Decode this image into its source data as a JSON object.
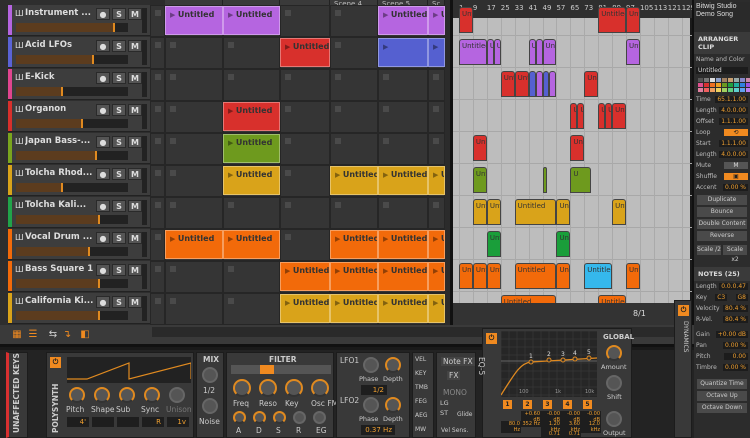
{
  "window": {
    "title": "Bitwig Studio Demo Song"
  },
  "tracks": [
    {
      "name": "Instrument ...",
      "color": "#b565e0",
      "level": 0.88
    },
    {
      "name": "Acid LFOs",
      "color": "#5a63d6",
      "level": 0.7
    },
    {
      "name": "E-Kick",
      "color": "#e0458f",
      "level": 0.42
    },
    {
      "name": "Organon",
      "color": "#d8302c",
      "level": 0.6
    },
    {
      "name": "Japan Bass-...",
      "color": "#7aa51e",
      "level": 0.72
    },
    {
      "name": "Tolcha Rhod...",
      "color": "#d9a31a",
      "level": 0.42
    },
    {
      "name": "Tolcha Kali...",
      "color": "#21a34a",
      "level": 0.75
    },
    {
      "name": "Vocal Drum ...",
      "color": "#f26a0a",
      "level": 0.66
    },
    {
      "name": "Bass Square 1",
      "color": "#f26a0a",
      "level": 0.75
    },
    {
      "name": "California Ki...",
      "color": "#d9a31a",
      "level": 0.75
    }
  ],
  "track_buttons": {
    "solo": "S",
    "mute": "M"
  },
  "scenes": [
    "",
    "",
    "",
    "Scene 4",
    "Scene 5",
    "Sc"
  ],
  "launcher_clips": [
    {
      "track": 0,
      "scene": 0,
      "label": "Untitled",
      "color": "#b565e0"
    },
    {
      "track": 0,
      "scene": 1,
      "label": "Untitled",
      "color": "#b565e0"
    },
    {
      "track": 0,
      "scene": 4,
      "label": "Untitled",
      "color": "#b565e0"
    },
    {
      "track": 0,
      "scene": 5,
      "label": "Un",
      "color": "#b565e0"
    },
    {
      "track": 1,
      "scene": 2,
      "label": "Untitled",
      "color": "#d8302c"
    },
    {
      "track": 1,
      "scene": 4,
      "label": "",
      "color": "#5560d0"
    },
    {
      "track": 1,
      "scene": 5,
      "label": "",
      "color": "#5560d0"
    },
    {
      "track": 3,
      "scene": 1,
      "label": "Untitled",
      "color": "#d8302c"
    },
    {
      "track": 4,
      "scene": 1,
      "label": "Untitled",
      "color": "#6e9a1e"
    },
    {
      "track": 5,
      "scene": 1,
      "label": "Untitled",
      "color": "#d9a31a"
    },
    {
      "track": 5,
      "scene": 3,
      "label": "Untitled",
      "color": "#d9a31a"
    },
    {
      "track": 5,
      "scene": 4,
      "label": "Untitled",
      "color": "#d9a31a"
    },
    {
      "track": 5,
      "scene": 5,
      "label": "Un",
      "color": "#d9a31a"
    },
    {
      "track": 7,
      "scene": 0,
      "label": "Untitled",
      "color": "#f26a0a"
    },
    {
      "track": 7,
      "scene": 1,
      "label": "Untitled",
      "color": "#f26a0a"
    },
    {
      "track": 7,
      "scene": 3,
      "label": "Untitled",
      "color": "#f26a0a"
    },
    {
      "track": 7,
      "scene": 4,
      "label": "Untitled",
      "color": "#f26a0a"
    },
    {
      "track": 7,
      "scene": 5,
      "label": "Un",
      "color": "#f26a0a"
    },
    {
      "track": 8,
      "scene": 2,
      "label": "Untitled",
      "color": "#f26a0a"
    },
    {
      "track": 8,
      "scene": 3,
      "label": "Untitled",
      "color": "#f26a0a"
    },
    {
      "track": 8,
      "scene": 4,
      "label": "Untitled",
      "color": "#f26a0a"
    },
    {
      "track": 8,
      "scene": 5,
      "label": "Un",
      "color": "#f26a0a"
    },
    {
      "track": 9,
      "scene": 2,
      "label": "Untitled",
      "color": "#d9a31a"
    },
    {
      "track": 9,
      "scene": 3,
      "label": "Untitled",
      "color": "#d9a31a"
    },
    {
      "track": 9,
      "scene": 4,
      "label": "Untitled",
      "color": "#d9a31a"
    },
    {
      "track": 9,
      "scene": 5,
      "label": "Un",
      "color": "#d9a31a"
    }
  ],
  "ruler": [
    "1",
    "9",
    "17",
    "25",
    "33",
    "41",
    "49",
    "57",
    "65",
    "73",
    "81",
    "89",
    "97",
    "105",
    "113",
    "121",
    "129"
  ],
  "arranger_clips": [
    {
      "track": -1,
      "start": 1,
      "end": 9,
      "label": "Unt",
      "color": "#d8302c"
    },
    {
      "track": 0,
      "start": 1,
      "end": 17,
      "label": "Untitled",
      "color": "#b565e0"
    },
    {
      "track": 0,
      "start": 17,
      "end": 21,
      "label": "U",
      "color": "#b565e0"
    },
    {
      "track": 0,
      "start": 21,
      "end": 25,
      "label": "U",
      "color": "#b565e0"
    },
    {
      "track": 0,
      "start": 41,
      "end": 45,
      "label": "U",
      "color": "#b565e0"
    },
    {
      "track": 0,
      "start": 45,
      "end": 49,
      "label": "",
      "color": "#b565e0"
    },
    {
      "track": 0,
      "start": 49,
      "end": 57,
      "label": "Unt",
      "color": "#b565e0"
    },
    {
      "track": -1,
      "start": 81,
      "end": 97,
      "label": "Untitled",
      "color": "#d8302c"
    },
    {
      "track": -1,
      "start": 97,
      "end": 105,
      "label": "Unt",
      "color": "#d8302c"
    },
    {
      "track": 1,
      "start": 25,
      "end": 33,
      "label": "Unt",
      "color": "#d8302c"
    },
    {
      "track": 1,
      "start": 33,
      "end": 41,
      "label": "Unt",
      "color": "#d8302c"
    },
    {
      "track": 1,
      "start": 41,
      "end": 45,
      "label": "",
      "color": "#5560d0"
    },
    {
      "track": 1,
      "start": 45,
      "end": 49,
      "label": "",
      "color": "#b565e0"
    },
    {
      "track": 1,
      "start": 49,
      "end": 53,
      "label": "",
      "color": "#5560d0"
    },
    {
      "track": 1,
      "start": 53,
      "end": 57,
      "label": "",
      "color": "#b565e0"
    },
    {
      "track": 1,
      "start": 73,
      "end": 81,
      "label": "Unt",
      "color": "#d8302c"
    },
    {
      "track": 0,
      "start": 97,
      "end": 105,
      "label": "Unt",
      "color": "#b565e0"
    },
    {
      "track": 2,
      "start": 65,
      "end": 69,
      "label": "U",
      "color": "#d8302c"
    },
    {
      "track": 2,
      "start": 69,
      "end": 73,
      "label": "U",
      "color": "#d8302c"
    },
    {
      "track": 2,
      "start": 81,
      "end": 85,
      "label": "U",
      "color": "#d8302c"
    },
    {
      "track": 2,
      "start": 85,
      "end": 89,
      "label": "U",
      "color": "#d8302c"
    },
    {
      "track": 2,
      "start": 89,
      "end": 97,
      "label": "Unt",
      "color": "#d8302c"
    },
    {
      "track": 3,
      "start": 9,
      "end": 17,
      "label": "Un",
      "color": "#d8302c"
    },
    {
      "track": 3,
      "start": 65,
      "end": 73,
      "label": "Unt",
      "color": "#d8302c"
    },
    {
      "track": 4,
      "start": 9,
      "end": 17,
      "label": "Unt",
      "color": "#6e9a1e"
    },
    {
      "track": 4,
      "start": 49,
      "end": 50,
      "label": "",
      "color": "#6e9a1e"
    },
    {
      "track": 4,
      "start": 65,
      "end": 77,
      "label": "U",
      "color": "#6e9a1e"
    },
    {
      "track": 5,
      "start": 9,
      "end": 17,
      "label": "Unt",
      "color": "#d9a31a"
    },
    {
      "track": 5,
      "start": 17,
      "end": 25,
      "label": "Unt",
      "color": "#d9a31a"
    },
    {
      "track": 5,
      "start": 33,
      "end": 57,
      "label": "Untitled",
      "color": "#d9a31a"
    },
    {
      "track": 5,
      "start": 57,
      "end": 65,
      "label": "Unt",
      "color": "#d9a31a"
    },
    {
      "track": 5,
      "start": 89,
      "end": 97,
      "label": "Unt",
      "color": "#d9a31a"
    },
    {
      "track": 6,
      "start": 17,
      "end": 25,
      "label": "Unt",
      "color": "#1a9e3a"
    },
    {
      "track": 6,
      "start": 57,
      "end": 65,
      "label": "Unt",
      "color": "#1a9e3a"
    },
    {
      "track": 7,
      "start": 1,
      "end": 9,
      "label": "Un",
      "color": "#f26a0a"
    },
    {
      "track": 7,
      "start": 9,
      "end": 17,
      "label": "Unt",
      "color": "#f26a0a"
    },
    {
      "track": 7,
      "start": 17,
      "end": 25,
      "label": "Unt",
      "color": "#f26a0a"
    },
    {
      "track": 7,
      "start": 33,
      "end": 57,
      "label": "Untitled",
      "color": "#f26a0a"
    },
    {
      "track": 7,
      "start": 57,
      "end": 65,
      "label": "Unt",
      "color": "#f26a0a"
    },
    {
      "track": 7,
      "start": 73,
      "end": 89,
      "label": "Untitled",
      "color": "#35b8ec"
    },
    {
      "track": 7,
      "start": 97,
      "end": 105,
      "label": "Unt",
      "color": "#f26a0a"
    },
    {
      "track": 8,
      "start": 25,
      "end": 57,
      "label": "Untitled",
      "color": "#f26a0a"
    },
    {
      "track": 8,
      "start": 81,
      "end": 97,
      "label": "Untitled",
      "color": "#f26a0a"
    },
    {
      "track": 9,
      "start": 25,
      "end": 57,
      "label": "Untitled",
      "color": "#d9a31a"
    },
    {
      "track": 9,
      "start": 65,
      "end": 73,
      "label": "",
      "color": "#d9a31a"
    },
    {
      "track": 9,
      "start": 73,
      "end": 81,
      "label": "Unt",
      "color": "#d9a31a"
    },
    {
      "track": 9,
      "start": 81,
      "end": 85,
      "label": "Ur",
      "color": "#d9a31a"
    },
    {
      "track": 9,
      "start": 85,
      "end": 93,
      "label": "Unt",
      "color": "#d9a31a"
    }
  ],
  "arranger_footer": {
    "grid": "8/1"
  },
  "inspector": {
    "clip_header": "ARRANGER CLIP",
    "name_color_label": "Name and Color",
    "clip_name": "Untitled",
    "palette": [
      "#555",
      "#777",
      "#ddd",
      "#8fa0c8",
      "#a08060",
      "#c8a070",
      "#9aa",
      "#88c",
      "#c8a",
      "#e05090",
      "#d83030",
      "#f07020",
      "#f0a020",
      "#6a9a20",
      "#20a040",
      "#20b0a0",
      "#3080e0",
      "#a050e0",
      "#e080a0",
      "#f06060",
      "#f0a060",
      "#f0d060",
      "#a0d060",
      "#60d080",
      "#60d0d0",
      "#60a0f0",
      "#c080f0"
    ],
    "rows1": [
      {
        "label": "Time",
        "value": "65.1.1.00"
      },
      {
        "label": "Length",
        "value": "4.0.0.00"
      },
      {
        "label": "Offset",
        "value": "1.1.1.00"
      }
    ],
    "loop_label": "Loop",
    "rows2": [
      {
        "label": "Start",
        "value": "1.1.1.00"
      },
      {
        "label": "Length",
        "value": "4.0.0.00"
      }
    ],
    "mute_label": "Mute",
    "mute_button": "M",
    "shuffle_label": "Shuffle",
    "accent": {
      "label": "Accent",
      "value": "0.00 %"
    },
    "buttons": [
      "Duplicate",
      "Bounce",
      "Double Content",
      "Reverse"
    ],
    "scale_half": "Scale /2",
    "scale_double": "Scale x2",
    "notes_header": "NOTES (25)",
    "note_length": {
      "label": "Length",
      "value": "0.0.0.47"
    },
    "key": {
      "label": "Key",
      "low": "C3",
      "high": "G8"
    },
    "rows3": [
      {
        "label": "Velocity",
        "value": "80.4 %"
      },
      {
        "label": "R-Vel.",
        "value": "80.4 %"
      }
    ],
    "rows4": [
      {
        "label": "Gain",
        "value": "+0.00 dB"
      },
      {
        "label": "Pan",
        "value": "0.00 %"
      },
      {
        "label": "Pitch",
        "value": "0.00"
      },
      {
        "label": "Timbre",
        "value": "0.00 %"
      }
    ],
    "note_buttons": [
      "Quantize Time",
      "Octave Up",
      "Octave Down"
    ]
  },
  "device": {
    "layer": "UNAFFECTED KEYS",
    "synth": "POLYSYNTH",
    "osc_knobs": [
      "Pitch",
      "Shape",
      "Sub",
      "Sync",
      "Unison"
    ],
    "osc_values": [
      "4'",
      "",
      "",
      "R",
      "1v"
    ],
    "mix": {
      "title": "MIX",
      "ratio": "1/2",
      "noise": "Noise"
    },
    "filter": {
      "title": "FILTER",
      "knobs": [
        "Freq",
        "Reso",
        "Key",
        "Osc FM"
      ],
      "env": [
        "A",
        "D",
        "S",
        "R",
        "EG"
      ]
    },
    "lfo1": {
      "title": "LFO1",
      "phase": "Phase",
      "depth": "Depth",
      "rate": "1/2"
    },
    "lfo2": {
      "title": "LFO2",
      "phase": "Phase",
      "depth": "Depth",
      "rate": "0.37 Hz"
    },
    "mods": [
      "VEL",
      "KEY",
      "TMB",
      "FEG",
      "AEG",
      "MW"
    ],
    "note_fx": "Note FX",
    "fx": "FX",
    "mono": "MONO",
    "lg": "LG",
    "st": "ST",
    "glide": "Glide",
    "vel_sens": "Vel Sens.",
    "eq": {
      "title": "EQ-5",
      "points": [
        "1",
        "2",
        "3",
        "4",
        "5"
      ],
      "freq_labels": [
        "100",
        "1k",
        "10k"
      ],
      "bands": [
        {
          "n": "1",
          "gain": "",
          "freq": "80.0 Hz",
          "q": ""
        },
        {
          "n": "2",
          "gain": "+0.60 dB",
          "freq": "352 Hz",
          "q": ""
        },
        {
          "n": "3",
          "gain": "-0.00 dB",
          "freq": "1.20 kHz",
          "q": "0.71"
        },
        {
          "n": "4",
          "gain": "-0.00 dB",
          "freq": "3.60 kHz",
          "q": "0.71"
        },
        {
          "n": "5",
          "gain": "-0.00 dB",
          "freq": "12.0 kHz",
          "q": ""
        }
      ]
    },
    "global": {
      "title": "GLOBAL",
      "amount": "Amount",
      "shift": "Shift",
      "output": "Output"
    },
    "dynamics": "DYNAMICS"
  }
}
